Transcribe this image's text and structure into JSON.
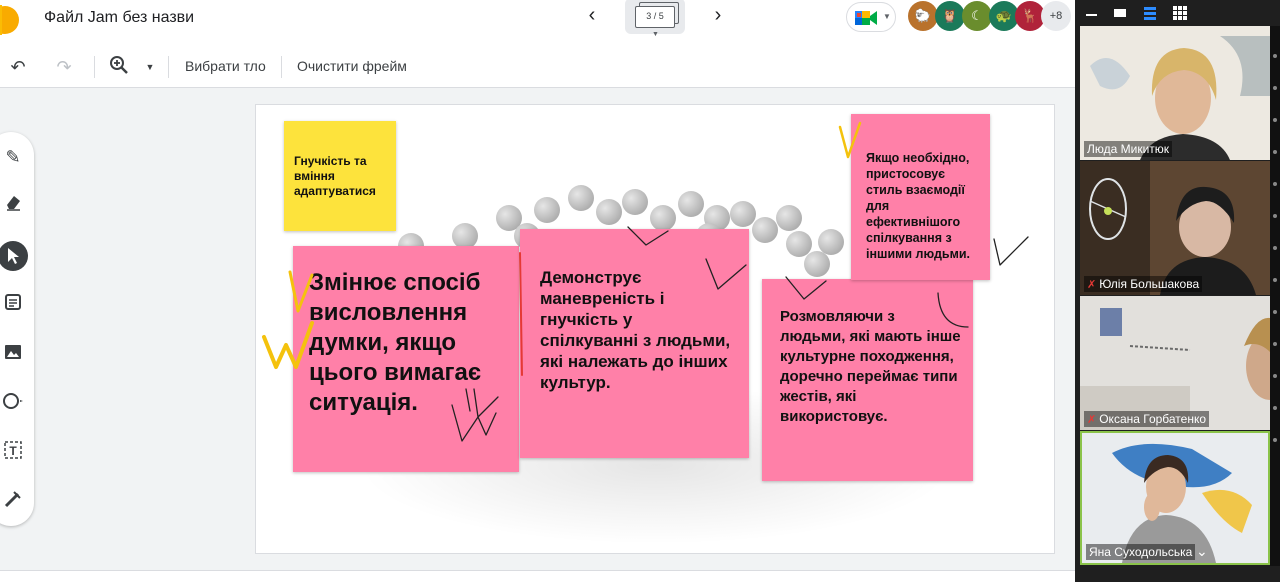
{
  "topbar": {
    "title": "Файл Jam без назви",
    "frame_counter": "3 / 5",
    "more_participants": "+8"
  },
  "toolbar": {
    "set_background": "Вибрати тло",
    "clear_frame": "Очистити фрейм"
  },
  "notes": {
    "yellow": "Гнучкість та вміння адаптуватися",
    "a": "Змінює спосіб висловлення думки, якщо цього вимагає ситуація.",
    "b": "Демонструє маневреність і гнучкість у спілкуванні з людьми, які належать до інших культур.",
    "c": "Розмовляючи з людьми, які мають інше культурне походження, доречно переймає типи жестів, які використовує.",
    "d": "Якщо необхідно, пристосовує стиль взаємодії для ефективнішого спілкування з іншими людьми."
  },
  "zoom": {
    "participants": [
      {
        "name": "Люда Микитюк",
        "muted": false
      },
      {
        "name": "Юлія Большакова",
        "muted": true
      },
      {
        "name": "Оксана Горбатенко",
        "muted": true
      },
      {
        "name": "Яна Суходольська",
        "muted": false
      }
    ]
  },
  "colors": {
    "note_pink": "#ff80a8",
    "note_yellow": "#fde33c",
    "active_speaker_border": "#8bc34a"
  }
}
